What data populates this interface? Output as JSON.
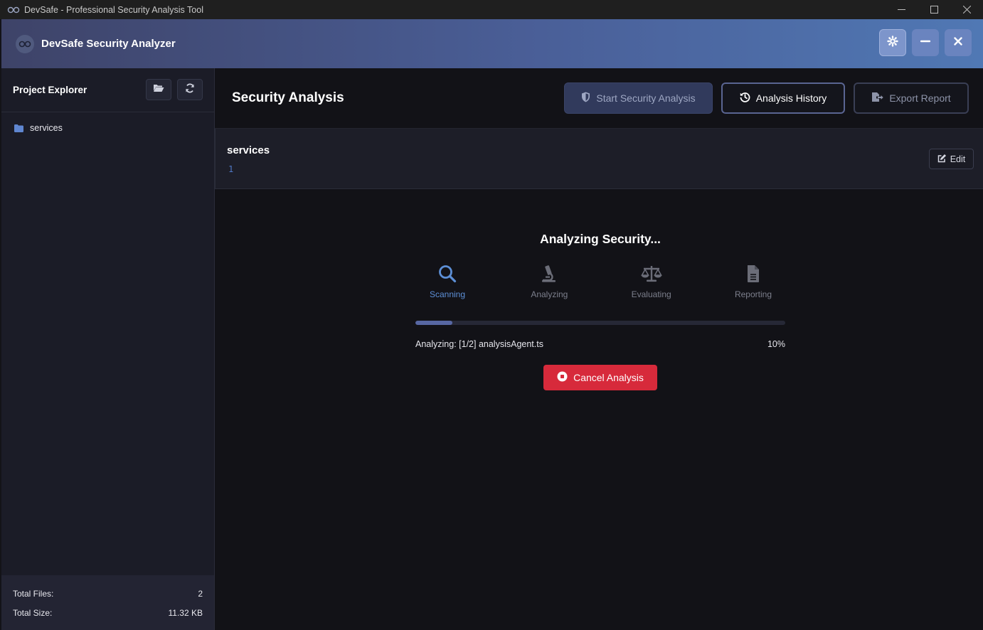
{
  "os": {
    "title": "DevSafe - Professional Security Analysis Tool"
  },
  "header": {
    "title": "DevSafe Security Analyzer"
  },
  "sidebar": {
    "title": "Project Explorer",
    "items": [
      {
        "label": "services"
      }
    ],
    "stats": {
      "total_files_label": "Total Files:",
      "total_files_value": "2",
      "total_size_label": "Total Size:",
      "total_size_value": "11.32 KB"
    }
  },
  "main": {
    "title": "Security Analysis",
    "actions": {
      "start_label": "Start Security Analysis",
      "history_label": "Analysis History",
      "export_label": "Export Report"
    },
    "file": {
      "name": "services",
      "line_number": "1",
      "edit_label": "Edit"
    },
    "progress": {
      "title": "Analyzing Security...",
      "steps": [
        {
          "label": "Scanning",
          "icon": "search-icon",
          "active": true
        },
        {
          "label": "Analyzing",
          "icon": "microscope-icon",
          "active": false
        },
        {
          "label": "Evaluating",
          "icon": "balance-scale-icon",
          "active": false
        },
        {
          "label": "Reporting",
          "icon": "file-text-icon",
          "active": false
        }
      ],
      "percent": 10,
      "percent_label": "10%",
      "status": "Analyzing: [1/2] analysisAgent.ts",
      "cancel_label": "Cancel Analysis"
    }
  },
  "colors": {
    "accent": "#5d8fd6",
    "danger": "#d72a3b",
    "header_start": "#3e4368",
    "header_end": "#5078b4"
  }
}
